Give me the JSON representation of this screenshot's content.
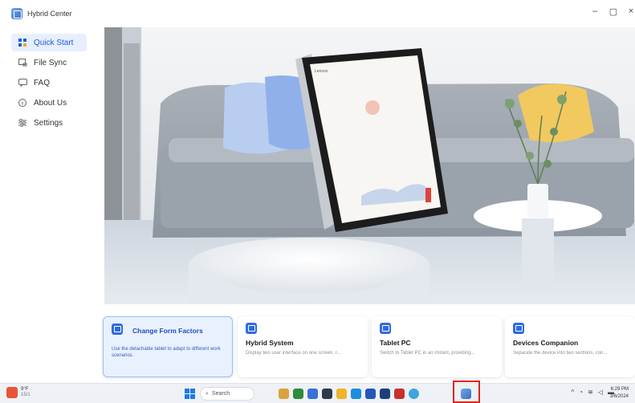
{
  "window": {
    "title": "Hybrid Center",
    "controls": {
      "minimize": "–",
      "maximize": "▢",
      "close": "×"
    }
  },
  "sidebar": {
    "items": [
      {
        "label": "Quick Start",
        "icon": "quick-start-icon",
        "active": true
      },
      {
        "label": "File Sync",
        "icon": "file-sync-icon",
        "active": false
      },
      {
        "label": "FAQ",
        "icon": "faq-icon",
        "active": false
      },
      {
        "label": "About Us",
        "icon": "info-icon",
        "active": false
      },
      {
        "label": "Settings",
        "icon": "settings-icon",
        "active": false
      }
    ]
  },
  "hero": {
    "brand_mark": "Lenovo"
  },
  "cards": [
    {
      "title": "Change Form Factors",
      "desc": "Use the detachable tablet to adapt to different work scenarios.",
      "active": true
    },
    {
      "title": "Hybrid System",
      "desc": "Display two user interface on one screen, r...",
      "active": false
    },
    {
      "title": "Tablet PC",
      "desc": "Switch to Tablet PC in an instant, providing...",
      "active": false
    },
    {
      "title": "Devices Companion",
      "desc": "Separate the device into two sections, con...",
      "active": false
    }
  ],
  "taskbar": {
    "weather_temp": "9°F",
    "weather_sub": "15/1",
    "search_placeholder": "Search",
    "time": "6:29 PM",
    "date": "3/6/2024"
  },
  "colors": {
    "accent": "#2f6be0",
    "active_bg": "#e7efff",
    "highlight": "#e0241b"
  }
}
